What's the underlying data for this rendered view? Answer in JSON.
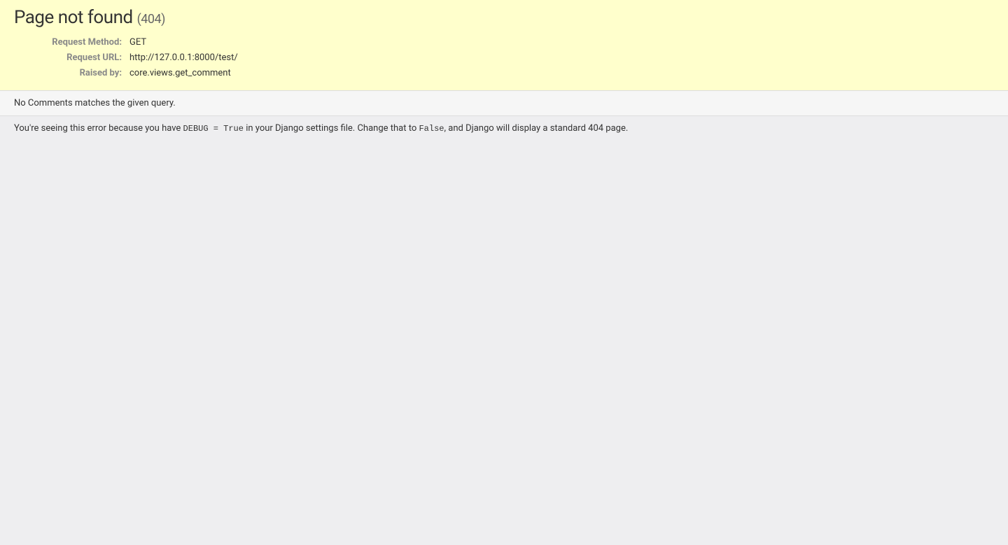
{
  "summary": {
    "title": "Page not found",
    "status_code": "(404)",
    "meta": {
      "request_method_label": "Request Method:",
      "request_method_value": "GET",
      "request_url_label": "Request URL:",
      "request_url_value": "http://127.0.0.1:8000/test/",
      "raised_by_label": "Raised by:",
      "raised_by_value": "core.views.get_comment"
    }
  },
  "info": {
    "message": "No Comments matches the given query."
  },
  "explanation": {
    "part1": "You're seeing this error because you have ",
    "code1": "DEBUG = True",
    "part2": " in your Django settings file. Change that to ",
    "code2": "False",
    "part3": ", and Django will display a standard 404 page."
  }
}
